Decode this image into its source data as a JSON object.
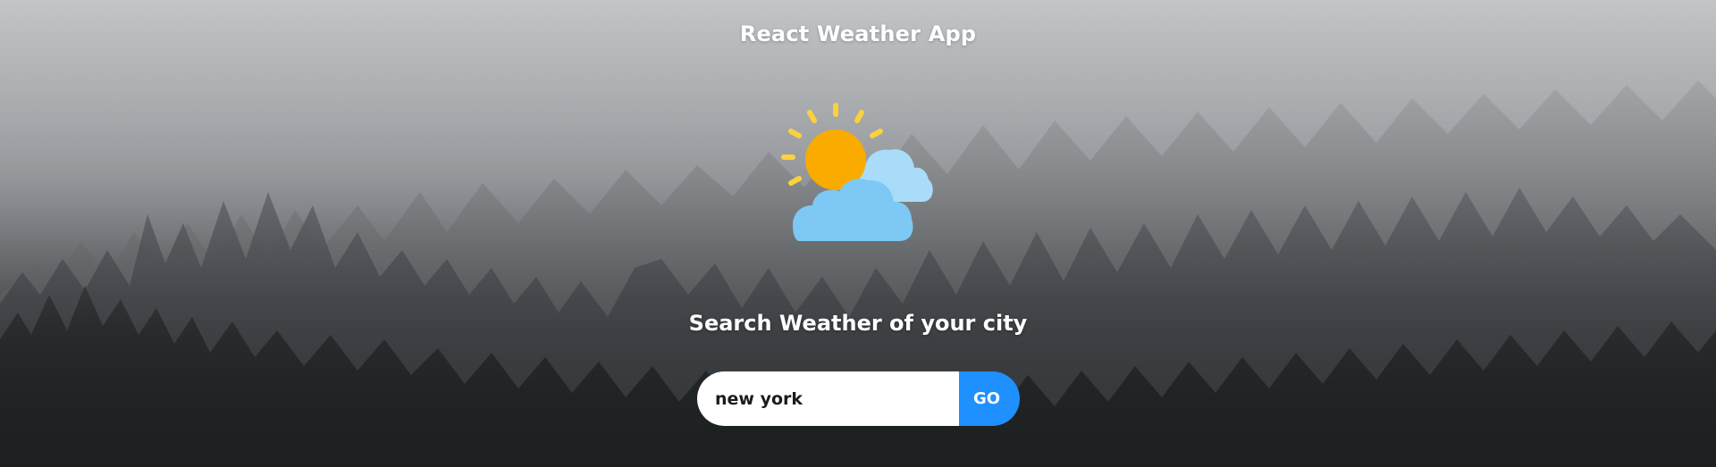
{
  "app": {
    "title": "React Weather App"
  },
  "hero": {
    "icon": "partly-cloudy-icon",
    "heading": "Search Weather of your city"
  },
  "search": {
    "value": "new york",
    "button_label": "GO"
  },
  "colors": {
    "accent": "#1e90ff",
    "sun": "#f9ab00",
    "sun_rays": "#fbd13d",
    "cloud_front": "#7ec8f5",
    "cloud_back": "#a9dcf8"
  }
}
